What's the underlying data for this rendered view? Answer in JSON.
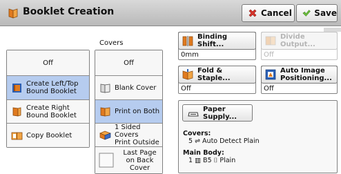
{
  "header": {
    "title": "Booklet Creation",
    "cancel_label": "Cancel",
    "save_label": "Save"
  },
  "booklet_options": {
    "items": [
      {
        "label": "Off",
        "selected": false
      },
      {
        "label": "Create Left/Top\nBound Booklet",
        "icon": "left-bound-booklet-icon",
        "selected": true
      },
      {
        "label": "Create Right\nBound Booklet",
        "icon": "right-bound-booklet-icon",
        "selected": false
      },
      {
        "label": "Copy Booklet",
        "icon": "copy-booklet-icon",
        "selected": false
      }
    ]
  },
  "covers": {
    "heading": "Covers",
    "items": [
      {
        "label": "Off",
        "selected": false
      },
      {
        "label": "Blank Cover",
        "icon": "blank-cover-icon",
        "selected": false
      },
      {
        "label": "Print on Both",
        "icon": "print-on-both-icon",
        "selected": true
      },
      {
        "label": "1 Sided Covers\nPrint Outside",
        "icon": "one-sided-covers-icon",
        "selected": false
      },
      {
        "label": "Last Page\non Back Cover",
        "icon": "checkbox-icon",
        "selected": false
      }
    ]
  },
  "binding_shift": {
    "label": "Binding Shift...",
    "value": "0mm",
    "icon": "binding-shift-icon"
  },
  "divide_output": {
    "label": "Divide Output...",
    "value": "Off",
    "icon": "divide-output-icon",
    "disabled": true
  },
  "fold_staple": {
    "label": "Fold & Staple...",
    "value": "Off",
    "icon": "fold-staple-icon"
  },
  "auto_image": {
    "label": "Auto Image\nPositioning...",
    "value": "Off",
    "icon": "auto-image-positioning-icon"
  },
  "paper_supply": {
    "button_label": "Paper Supply...",
    "icon": "paper-tray-icon",
    "covers_label": "Covers:",
    "covers_value": "5 ⇌ Auto Detect Plain",
    "main_body_label": "Main Body:",
    "main_body_value": "1 ▥ B5 ⌷ Plain"
  },
  "colors": {
    "selected": "#b6ccef",
    "cancel_x": "#d9342b",
    "save_check": "#6cbf3d"
  }
}
